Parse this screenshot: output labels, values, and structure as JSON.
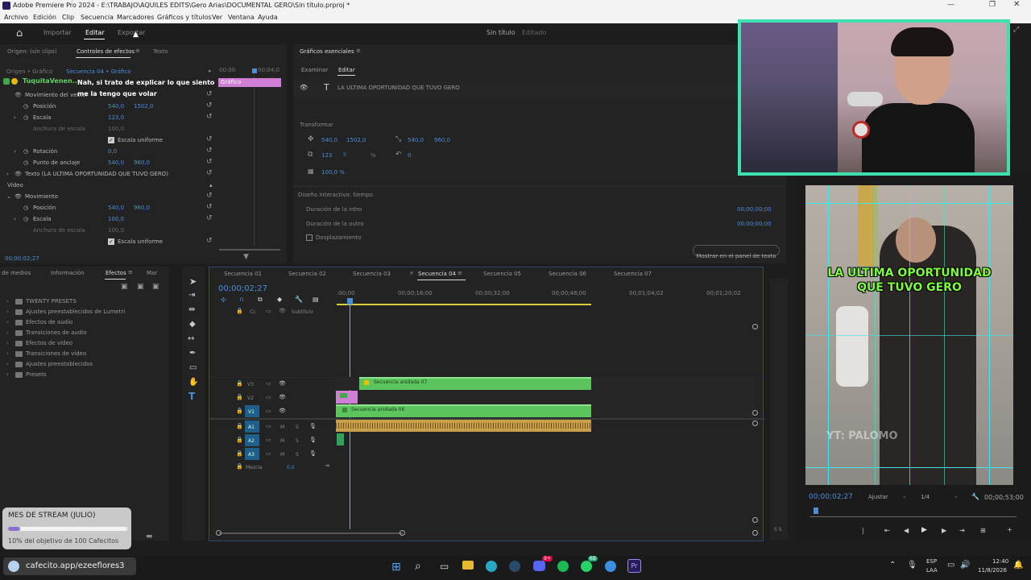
{
  "app": {
    "title": "Adobe Premiere Pro 2024 - E:\\TRABAJO\\AQUILES EDITS\\Gero Arias\\DOCUMENTAL GERO\\Sin título.prproj *"
  },
  "menu": [
    "Archivo",
    "Edición",
    "Clip",
    "Secuencia",
    "Marcadores",
    "Gráficos y títulos",
    "Ver",
    "Ventana",
    "Ayuda"
  ],
  "workspace": {
    "tabs": [
      "Importar",
      "Editar",
      "Exportar"
    ],
    "project_title": "Sin título",
    "project_state": "Editado"
  },
  "effect_controls": {
    "tabs": [
      "Origen: (sin clips)",
      "Controles de efectos",
      "Texto"
    ],
    "source": "Origen • Gráfico",
    "sequence": "Secuencia 04 • Gráfico",
    "timecode_start": "00:00",
    "timecode_end": "00;04;0",
    "clip_label": "Gráfico",
    "rows": [
      {
        "label": "Movimiento del vector",
        "v1": "",
        "v2": ""
      },
      {
        "label": "Posición",
        "v1": "540,0",
        "v2": "1502,0"
      },
      {
        "label": "Escala",
        "v1": "123,0",
        "v2": ""
      },
      {
        "label": "Anchura de escala",
        "v1": "100,0",
        "v2": ""
      },
      {
        "label": "Escala uniforme",
        "v1": "",
        "v2": ""
      },
      {
        "label": "Rotación",
        "v1": "0,0",
        "v2": ""
      },
      {
        "label": "Punto de anclaje",
        "v1": "540,0",
        "v2": "960,0"
      },
      {
        "label": "Texto (LA ULTIMA OPORTUNIDAD QUE TUVO GERO)",
        "v1": "",
        "v2": ""
      },
      {
        "label": "Vídeo",
        "v1": "",
        "v2": ""
      },
      {
        "label": "Movimiento",
        "v1": "",
        "v2": ""
      },
      {
        "label": "Posición",
        "v1": "540,0",
        "v2": "960,0"
      },
      {
        "label": "Escala",
        "v1": "100,0",
        "v2": ""
      },
      {
        "label": "Anchura de escala",
        "v1": "100,0",
        "v2": ""
      },
      {
        "label": "Escala uniforme",
        "v1": "",
        "v2": ""
      },
      {
        "label": "Rotación",
        "v1": "0,0",
        "v2": ""
      }
    ],
    "bottom_timecode": "00;00;02;27"
  },
  "chat": {
    "user": "TuquitaVenen...",
    "message": "Nah, si trato de explicar lo que siento me la tengo que volar"
  },
  "essential_graphics": {
    "title": "Gráficos esenciales",
    "tabs": [
      "Examinar",
      "Editar"
    ],
    "layer": "LA ULTIMA OPORTUNIDAD QUE TUVO GERO",
    "transform_label": "Transformar",
    "pos_x": "540,0",
    "pos_y": "1502,0",
    "anchor_x": "540,0",
    "anchor_y": "960,0",
    "scale": "123",
    "scale_unit": "%",
    "rotation": "0",
    "opacity": "100,0 %",
    "responsive_label": "Diseño interactivo: tiempo",
    "intro_label": "Duración de la intro",
    "intro_value": "00;00;00;00",
    "outro_label": "Duración de la outro",
    "outro_value": "00;00;00;00",
    "scroll_label": "Desplazamiento",
    "show_button": "Mostrar en el panel de texto"
  },
  "project": {
    "tabs": [
      "de medios",
      "Información",
      "Efectos",
      "Mar"
    ],
    "items": [
      "TWENTY PRESETS",
      "Ajustes preestablecidos de Lumetri",
      "Efectos de audio",
      "Transiciones de audio",
      "Efectos de vídeo",
      "Transiciones de vídeo",
      "Ajustes preestablecidos",
      "Presets"
    ]
  },
  "timeline": {
    "tabs": [
      "Secuencia 01",
      "Secuencia 02",
      "Secuencia 03",
      "Secuencia 04",
      "Secuencia 05",
      "Secuencia 06",
      "Secuencia 07"
    ],
    "active_tab": "Secuencia 04",
    "timecode": "00;00;02;27",
    "ruler": [
      ":00;00",
      "00;00;16;00",
      "00;00;32;00",
      "00;00;48;00",
      "00;01;04;02",
      "00;01;20;02"
    ],
    "caption_track": "Subtítulo",
    "cc_label": "CL",
    "video_tracks": [
      "V3",
      "V2",
      "V1"
    ],
    "audio_tracks": [
      "A1",
      "A2",
      "A3"
    ],
    "mix_label": "Mezcla",
    "mix_value": "0,0",
    "m": "M",
    "s": "S",
    "clip_v3": "Secuencia anidada 07",
    "clip_v1": "Secuencia anidada 06"
  },
  "program": {
    "timecode": "00;00;02;27",
    "fit": "Ajustar",
    "ratio": "1/4",
    "duration": "00;00;53;00",
    "caption_line1": "LA ULTIMA OPORTUNIDAD",
    "caption_line2": "QUE TUVO GERO",
    "watermark": "YT: PALOMO"
  },
  "stream": {
    "goal_title": "MES DE STREAM (JULIO)",
    "goal_text": "10% del objetivo de 100 Cafecitos",
    "goal_progress": 0.1,
    "link": "cafecito.app/ezeeflores3"
  },
  "taskbar": {
    "lang1": "ESP",
    "lang2": "LAA",
    "time": "12:40",
    "date": "11/8/2026",
    "badge1": "9+",
    "badge2": "68"
  },
  "colors": {
    "accent_blue": "#4a8ed8",
    "clip_green": "#5cc45c",
    "audio_orange": "#c8a04a",
    "graphic_pink": "#d17ed6",
    "cam_border": "#3fe0b0",
    "caption_green": "#7dff3c"
  }
}
